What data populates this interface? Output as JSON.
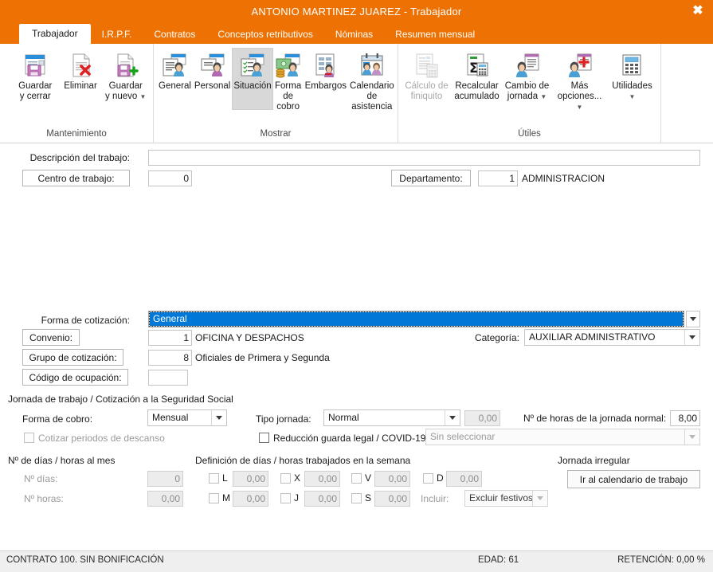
{
  "window": {
    "title": "ANTONIO MARTINEZ JUAREZ - Trabajador",
    "close_icon": "close-icon",
    "accent_color": "#ED7203",
    "highlight_color": "#0078D7"
  },
  "tabs": [
    {
      "label": "Trabajador",
      "active": true
    },
    {
      "label": "I.R.P.F.",
      "active": false
    },
    {
      "label": "Contratos",
      "active": false
    },
    {
      "label": "Conceptos retributivos",
      "active": false
    },
    {
      "label": "Nóminas",
      "active": false
    },
    {
      "label": "Resumen mensual",
      "active": false
    }
  ],
  "ribbon": {
    "groups": [
      {
        "label": "Mantenimiento",
        "buttons": [
          {
            "label": "Guardar\ny cerrar",
            "icon": "save-close-icon",
            "disabled": false,
            "selected": false,
            "dropdown": false
          },
          {
            "label": "Eliminar",
            "icon": "delete-document-icon",
            "disabled": false,
            "selected": false,
            "dropdown": false
          },
          {
            "label": "Guardar\ny nuevo",
            "icon": "save-new-icon",
            "disabled": false,
            "selected": false,
            "dropdown": true
          }
        ]
      },
      {
        "label": "Mostrar",
        "buttons": [
          {
            "label": "General",
            "icon": "person-card-icon",
            "disabled": false,
            "selected": false,
            "dropdown": false
          },
          {
            "label": "Personal",
            "icon": "person-personal-icon",
            "disabled": false,
            "selected": false,
            "dropdown": false
          },
          {
            "label": "Situación",
            "icon": "person-checklist-icon",
            "disabled": false,
            "selected": true,
            "dropdown": false
          },
          {
            "label": "Forma\nde cobro",
            "icon": "person-money-icon",
            "disabled": false,
            "selected": false,
            "dropdown": false
          },
          {
            "label": "Embargos",
            "icon": "person-document-icon",
            "disabled": false,
            "selected": false,
            "dropdown": false
          },
          {
            "label": "Calendario\nde asistencia",
            "icon": "calendar-people-icon",
            "disabled": false,
            "selected": false,
            "dropdown": false
          }
        ]
      },
      {
        "label": "Útiles",
        "buttons": [
          {
            "label": "Cálculo de\nfiniquito",
            "icon": "calculator-document-icon",
            "disabled": true,
            "selected": false,
            "dropdown": false
          },
          {
            "label": "Recalcular\nacumulado",
            "icon": "sigma-calculator-icon",
            "disabled": false,
            "selected": false,
            "dropdown": false
          },
          {
            "label": "Cambio de\njornada",
            "icon": "person-schedule-icon",
            "disabled": false,
            "selected": false,
            "dropdown": true
          },
          {
            "label": "Más\nopciones...",
            "icon": "person-plus-icon",
            "disabled": false,
            "selected": false,
            "dropdown": true
          },
          {
            "label": "Utilidades",
            "icon": "calculator-icon",
            "disabled": false,
            "selected": false,
            "dropdown": true
          }
        ]
      }
    ]
  },
  "form": {
    "descripcion_label": "Descripción del trabajo:",
    "descripcion_value": "",
    "centro_trabajo_button": "Centro de trabajo:",
    "centro_trabajo_code": "0",
    "departamento_button": "Departamento:",
    "departamento_code": "1",
    "departamento_name": "ADMINISTRACION",
    "forma_cotizacion_label": "Forma de cotización:",
    "forma_cotizacion_value": "General",
    "convenio_button": "Convenio:",
    "convenio_code": "1",
    "convenio_name": "OFICINA Y DESPACHOS",
    "categoria_label": "Categoría:",
    "categoria_value": "AUXILIAR ADMINISTRATIVO",
    "grupo_cotizacion_button": "Grupo de cotización:",
    "grupo_cotizacion_code": "8",
    "grupo_cotizacion_name": "Oficiales de Primera y Segunda",
    "codigo_ocupacion_button": "Código de ocupación:",
    "codigo_ocupacion_value": ""
  },
  "jornada": {
    "section_title": "Jornada de trabajo / Cotización a la Seguridad Social",
    "forma_cobro_label": "Forma de cobro:",
    "forma_cobro_value": "Mensual",
    "tipo_jornada_label": "Tipo jornada:",
    "tipo_jornada_value": "Normal",
    "tipo_jornada_pct": "0,00",
    "horas_normal_label": "Nº de horas de la jornada normal:",
    "horas_normal_value": "8,00",
    "cotizar_descanso_label": "Cotizar periodos de descanso",
    "cotizar_descanso_checked": false,
    "reduccion_label": "Reducción guarda legal / COVID-19",
    "reduccion_checked": false,
    "reduccion_value": "Sin seleccionar"
  },
  "dias_mes": {
    "section_title": "Nº de días / horas al mes",
    "dias_label": "Nº días:",
    "dias_value": "0",
    "horas_label": "Nº horas:",
    "horas_value": "0,00"
  },
  "semana": {
    "section_title": "Definición de días / horas trabajados en la semana",
    "days": [
      {
        "code": "L",
        "value": "0,00",
        "checked": false
      },
      {
        "code": "M",
        "value": "0,00",
        "checked": false
      },
      {
        "code": "X",
        "value": "0,00",
        "checked": false
      },
      {
        "code": "J",
        "value": "0,00",
        "checked": false
      },
      {
        "code": "V",
        "value": "0,00",
        "checked": false
      },
      {
        "code": "S",
        "value": "0,00",
        "checked": false
      },
      {
        "code": "D",
        "value": "0,00",
        "checked": false
      }
    ],
    "incluir_label": "Incluir:",
    "incluir_value": "Excluir festivos"
  },
  "jornada_irregular": {
    "section_title": "Jornada irregular",
    "button_label": "Ir al calendario de trabajo"
  },
  "statusbar": {
    "left": "CONTRATO 100.  SIN BONIFICACIÓN",
    "middle": "EDAD: 61",
    "right": "RETENCIÓN: 0,00 %"
  }
}
